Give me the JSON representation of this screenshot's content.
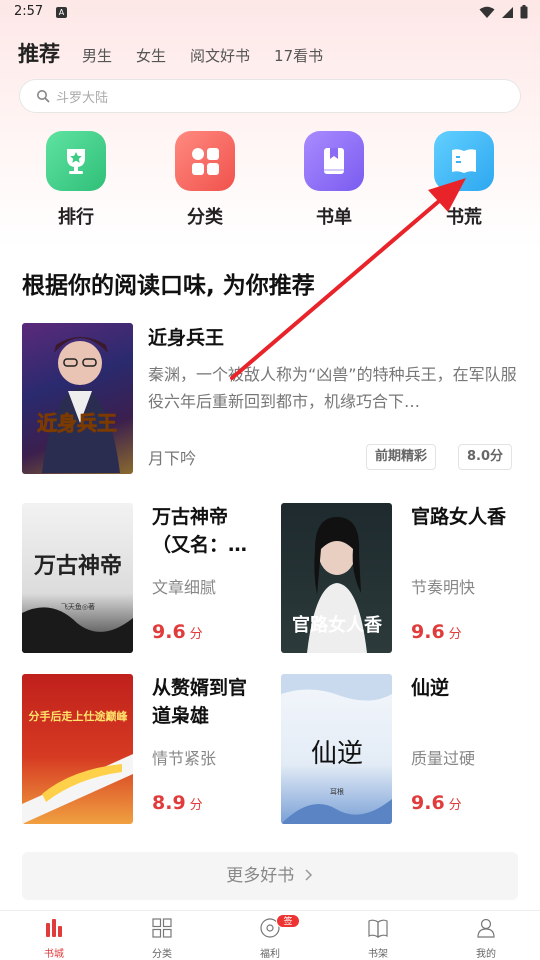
{
  "status": {
    "time": "2:57",
    "app_badge": "A"
  },
  "tabs": {
    "main": "推荐",
    "items": [
      "男生",
      "女生",
      "阅文好书",
      "17看书"
    ]
  },
  "search": {
    "placeholder": "斗罗大陆"
  },
  "categories": [
    {
      "label": "排行",
      "icon": "trophy-icon",
      "color": "#3ccc86"
    },
    {
      "label": "分类",
      "icon": "grid-icon",
      "color": "#ff6b64"
    },
    {
      "label": "书单",
      "icon": "bookmark-book-icon",
      "color": "#8b6cf5"
    },
    {
      "label": "书荒",
      "icon": "open-book-icon",
      "color": "#3ab3f5"
    }
  ],
  "section_title": "根据你的阅读口味, 为你推荐",
  "featured": {
    "title": "近身兵王",
    "description": "秦渊，一个被敌人称为“凶兽”的特种兵王，在军队服役六年后重新回到都市，机缘巧合下…",
    "author": "月下吟",
    "tags": [
      "前期精彩",
      "8.0分"
    ],
    "cover_text": "近身兵王"
  },
  "grid": [
    {
      "title": "万古神帝（又名：…",
      "subtitle": "文章细腻",
      "score": "9.6",
      "unit": "分",
      "cover_text": "万古神帝",
      "cover_author": "飞天鱼◎著"
    },
    {
      "title": "官路女人香",
      "subtitle": "节奏明快",
      "score": "9.6",
      "unit": "分",
      "cover_text": "官路女人香"
    },
    {
      "title": "从赘婿到官道枭雄",
      "subtitle": "情节紧张",
      "score": "8.9",
      "unit": "分",
      "cover_text": "分手后走上仕途巅峰"
    },
    {
      "title": "仙逆",
      "subtitle": "质量过硬",
      "score": "9.6",
      "unit": "分",
      "cover_text": "仙逆",
      "cover_author": "耳根"
    }
  ],
  "more_button": "更多好书",
  "tabbar": [
    {
      "label": "书城",
      "icon": "bookstore-icon",
      "active": true
    },
    {
      "label": "分类",
      "icon": "category-icon",
      "active": false
    },
    {
      "label": "福利",
      "icon": "welfare-icon",
      "active": false,
      "badge": "签到"
    },
    {
      "label": "书架",
      "icon": "bookshelf-icon",
      "active": false
    },
    {
      "label": "我的",
      "icon": "profile-icon",
      "active": false
    }
  ]
}
